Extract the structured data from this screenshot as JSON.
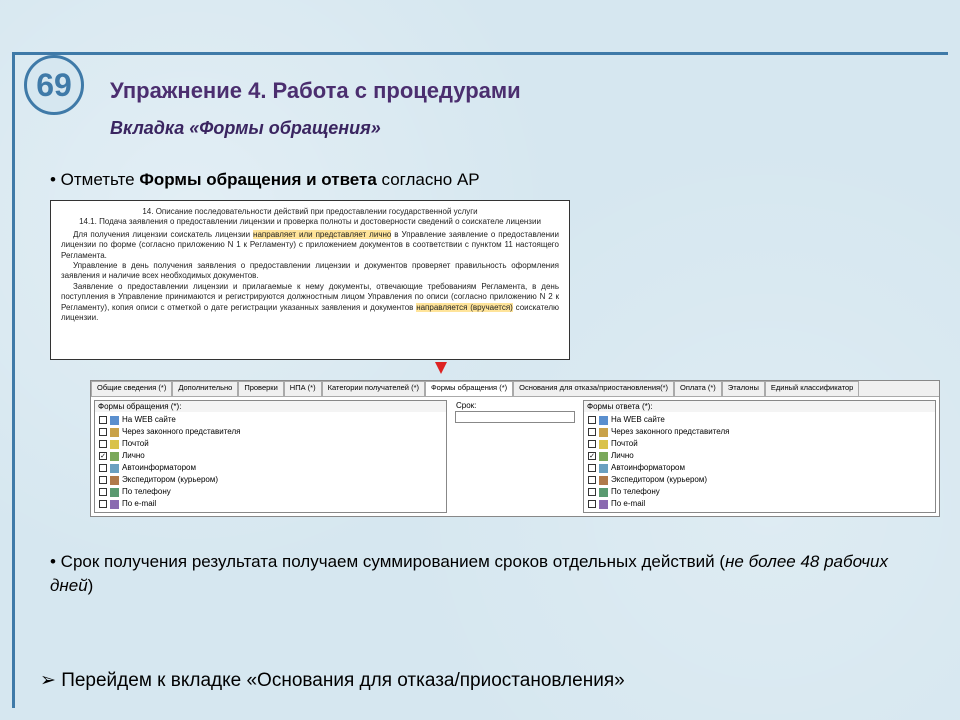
{
  "page_number": "69",
  "title": "Упражнение 4. Работа с процедурами",
  "subtitle": "Вкладка «Формы обращения»",
  "bullet1_prefix": "• Отметьте ",
  "bullet1_bold": "Формы обращения и ответа",
  "bullet1_suffix": " согласно АР",
  "doc_text": {
    "h1": "14. Описание последовательности действий при предоставлении государственной услуги",
    "h2": "14.1. Подача заявления о предоставлении лицензии и проверка полноты и достоверности сведений о соискателе лицензии",
    "p1a": "Для получения лицензии соискатель лицензии ",
    "p1_hl": "направляет или представляет лично",
    "p1b": " в Управление заявление о предоставлении лицензии по форме (согласно приложению N 1 к Регламенту) с приложением документов в соответствии с пунктом 11 настоящего Регламента.",
    "p2": "Управление в день получения заявления о предоставлении лицензии и документов проверяет правильность оформления заявления и наличие всех необходимых документов.",
    "p3a": "Заявление о предоставлении лицензии и прилагаемые к нему документы, отвечающие требованиям Регламента, в день поступления в Управление принимаются и регистрируются должностным лицом Управления по описи (согласно приложению N 2 к Регламенту), копия описи с отметкой о дате регистрации указанных заявления и документов ",
    "p3_hl": "направляется (вручается)",
    "p3b": " соискателю лицензии."
  },
  "tabs": [
    "Общие сведения (*)",
    "Дополнительно",
    "Проверки",
    "НПА (*)",
    "Категории получателей (*)",
    "Формы обращения (*)",
    "Основания для отказа/приостановления(*)",
    "Оплата (*)",
    "Эталоны",
    "Единый классификатор"
  ],
  "left_header": "Формы обращения (*):",
  "right_header": "Формы ответа (*):",
  "srok_label": "Срок:",
  "items": [
    {
      "name": "На WEB сайте",
      "left_checked": false,
      "right_checked": false,
      "color": "#5a8fce"
    },
    {
      "name": "Через законного представителя",
      "left_checked": false,
      "right_checked": false,
      "color": "#c9a24a"
    },
    {
      "name": "Почтой",
      "left_checked": false,
      "right_checked": false,
      "color": "#d9c24a"
    },
    {
      "name": "Лично",
      "left_checked": true,
      "right_checked": true,
      "color": "#7aa85a"
    },
    {
      "name": "Автоинформатором",
      "left_checked": false,
      "right_checked": false,
      "color": "#6aa0c0"
    },
    {
      "name": "Экспедитором (курьером)",
      "left_checked": false,
      "right_checked": false,
      "color": "#b07a4a"
    },
    {
      "name": "По телефону",
      "left_checked": false,
      "right_checked": false,
      "color": "#5a9a70"
    },
    {
      "name": "По e-mail",
      "left_checked": false,
      "right_checked": false,
      "color": "#8a6ab0"
    }
  ],
  "bullet2_prefix": "• Срок получения результата получаем суммированием сроков отдельных действий (",
  "bullet2_italic": "не более 48 рабочих дней",
  "bullet2_suffix": ")",
  "footer": "Перейдем к вкладке «Основания для отказа/приостановления»"
}
